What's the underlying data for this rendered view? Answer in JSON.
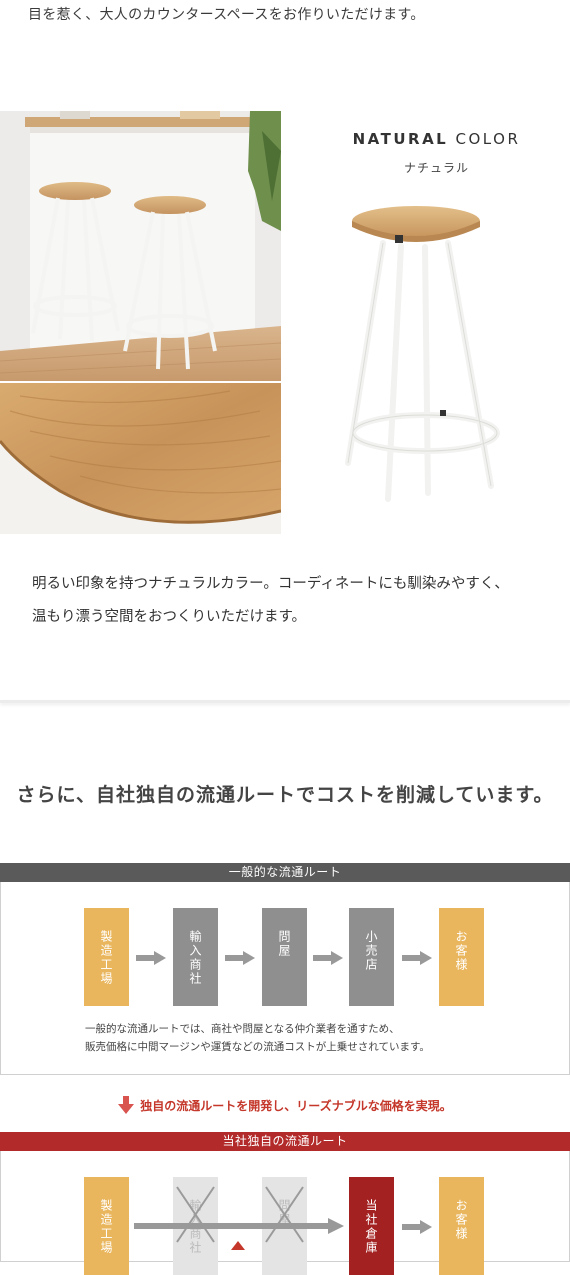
{
  "intro_text": "目を惹く、大人のカウンタースペースをお作りいただけます。",
  "color": {
    "title_bold": "NATURAL",
    "title_light": "COLOR",
    "subtitle": "ナチュラル"
  },
  "description": {
    "line1": "明るい印象を持つナチュラルカラー。コーディネートにも馴染みやすく、",
    "line2": "温もり漂う空間をおつくりいただけます。"
  },
  "headline": "さらに、自社独自の流通ルートでコストを削減しています。",
  "general_route": {
    "title": "一般的な流通ルート",
    "steps": [
      "製造工場",
      "輸入商社",
      "問屋",
      "小売店",
      "お客様"
    ],
    "note_line1": "一般的な流通ルートでは、商社や問屋となる仲介業者を通すため、",
    "note_line2": "販売価格に中間マージンや運賃などの流通コストが上乗せされています。"
  },
  "reveal_text": "独自の流通ルートを開発し、リーズナブルな価格を実現。",
  "own_route": {
    "title": "当社独自の流通ルート",
    "steps": [
      "製造工場",
      "輸入商社",
      "問屋",
      "当社倉庫",
      "お客様"
    ]
  },
  "colors": {
    "yellow": "#e9b65d",
    "gray": "#8f8f8f",
    "red": "#a42121",
    "accent_red": "#c4372a"
  }
}
